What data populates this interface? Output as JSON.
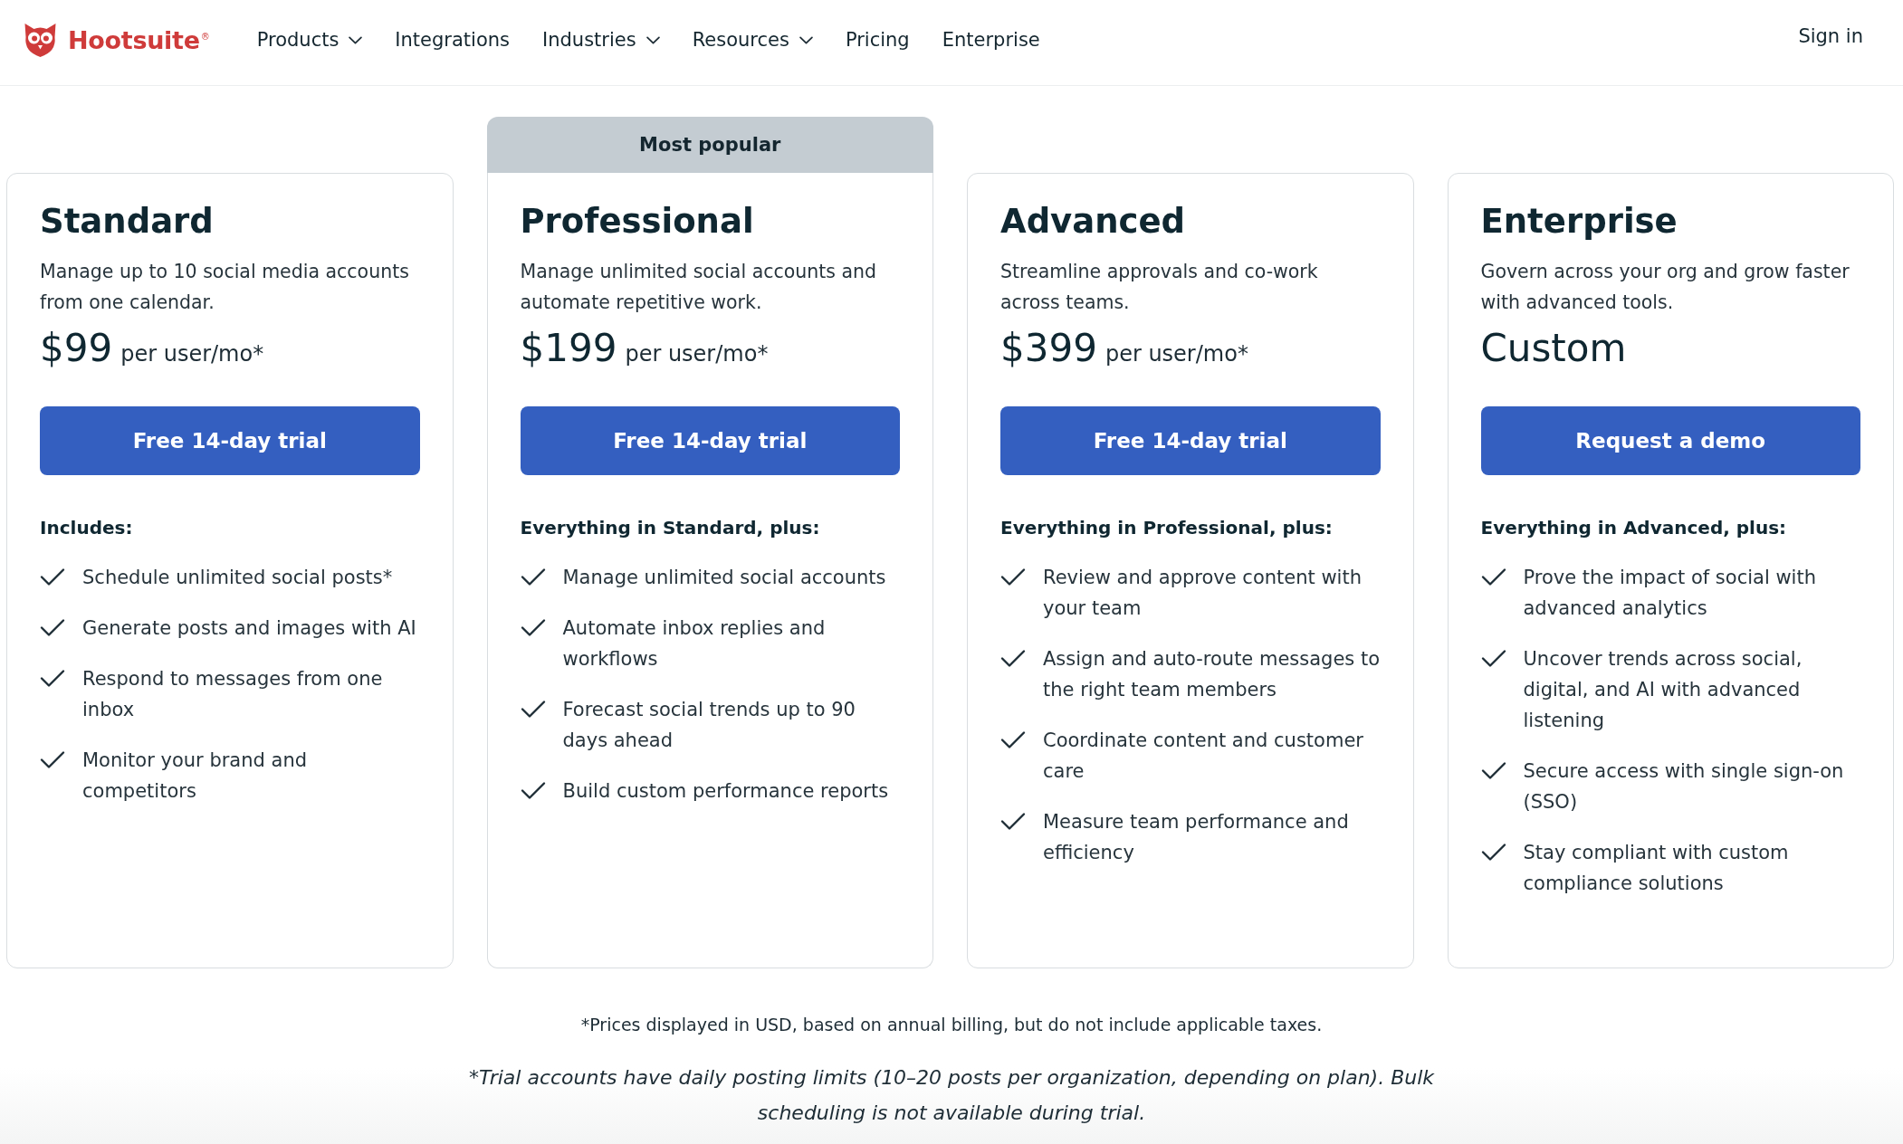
{
  "header": {
    "logo": {
      "name": "Hootsuite",
      "mark": "®"
    },
    "nav": [
      {
        "label": "Products",
        "dropdown": true
      },
      {
        "label": "Integrations",
        "dropdown": false
      },
      {
        "label": "Industries",
        "dropdown": true
      },
      {
        "label": "Resources",
        "dropdown": true
      },
      {
        "label": "Pricing",
        "dropdown": false
      },
      {
        "label": "Enterprise",
        "dropdown": false
      }
    ],
    "sign_in": "Sign in"
  },
  "plans": [
    {
      "name": "Standard",
      "description": "Manage up to 10 social media accounts from one calendar.",
      "price": "$99",
      "price_unit": "per user/mo*",
      "button": "Free 14-day trial",
      "includes": "Includes:",
      "features": [
        "Schedule unlimited social posts*",
        "Generate posts and images with AI",
        "Respond to messages from one inbox",
        "Monitor your brand and competitors"
      ]
    },
    {
      "badge": "Most popular",
      "name": "Professional",
      "description": "Manage unlimited social accounts and automate repetitive work.",
      "price": "$199",
      "price_unit": "per user/mo*",
      "button": "Free 14-day trial",
      "includes": "Everything in Standard, plus:",
      "features": [
        "Manage unlimited social accounts",
        "Automate inbox replies and workflows",
        "Forecast social trends up to 90 days ahead",
        "Build custom performance reports"
      ]
    },
    {
      "name": "Advanced",
      "description": "Streamline approvals and co-work across teams.",
      "price": "$399",
      "price_unit": "per user/mo*",
      "button": "Free 14-day trial",
      "includes": "Everything in Professional, plus:",
      "features": [
        "Review and approve content with your team",
        "Assign and auto-route messages to the right team members",
        "Coordinate content and customer care",
        "Measure team performance and efficiency"
      ]
    },
    {
      "name": "Enterprise",
      "description": "Govern across your org and grow faster with advanced tools.",
      "price": "Custom",
      "button": "Request a demo",
      "includes": "Everything in Advanced, plus:",
      "features": [
        "Prove the impact of social with advanced analytics",
        "Uncover trends across social, digital, and AI with advanced listening",
        "Secure access with single sign-on (SSO)",
        "Stay compliant with custom compliance solutions"
      ]
    }
  ],
  "footnotes": {
    "price_note": "*Prices displayed in USD, based on annual billing, but do not include applicable taxes.",
    "trial_note": "*Trial accounts have daily posting limits (10–20 posts per organization, depending on plan). Bulk scheduling is not available during trial."
  }
}
